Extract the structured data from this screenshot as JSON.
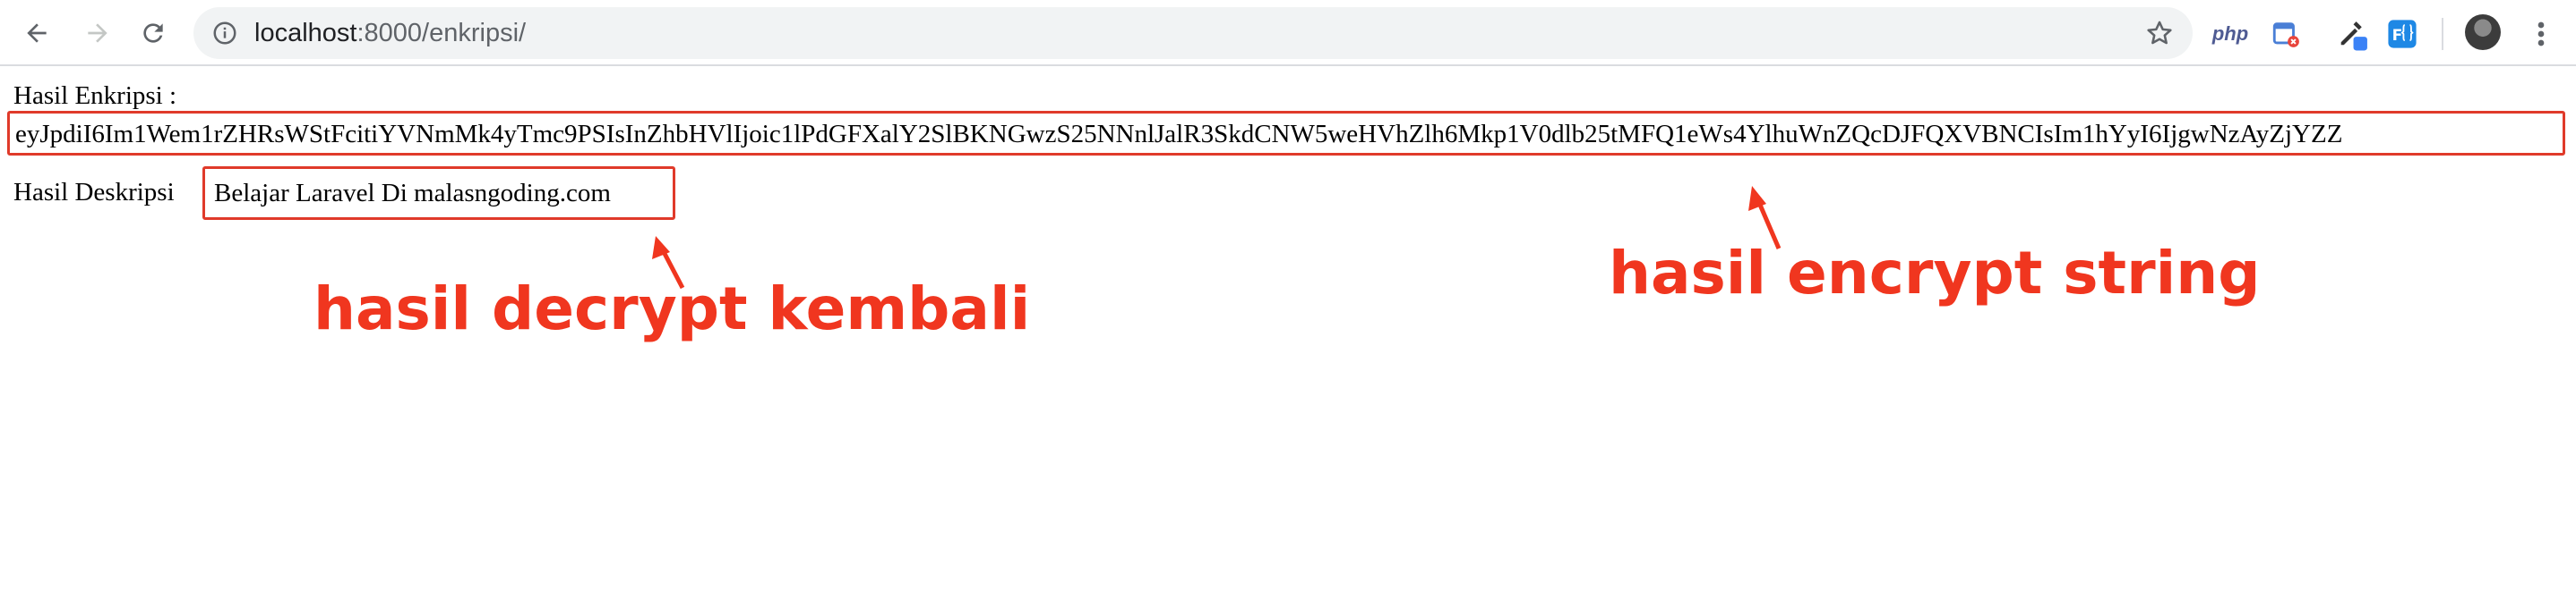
{
  "browser": {
    "url_host": "localhost",
    "url_rest": ":8000/enkripsi/",
    "extensions": {
      "php_label": "php"
    },
    "icons": [
      "back-arrow-icon",
      "forward-arrow-icon",
      "reload-icon",
      "info-icon",
      "star-icon",
      "calendar-extension-icon",
      "color-picker-icon",
      "fi-extension-icon",
      "avatar",
      "more-vert-icon"
    ]
  },
  "page": {
    "encrypt_label": "Hasil Enkripsi :",
    "encrypt_value": "eyJpdiI6Im1Wem1rZHRsWStFcitiYVNmMk4yTmc9PSIsInZhbHVlIjoic1lPdGFXalY2SlBKNGwzS25NNnlJalR3SkdCNW5weHVhZlh6Mkp1V0dlb25tMFQ1eWs4YlhuWnZQcDJFQXVBNCIsIm1hYyI6IjgwNzAyZjYZZ",
    "decrypt_label": "Hasil Deskripsi",
    "decrypt_value": "Belajar Laravel Di malasngoding.com"
  },
  "annotations": {
    "decrypt_note": "hasil decrypt kembali",
    "encrypt_note": "hasil encrypt string",
    "color": "#f0361f"
  }
}
